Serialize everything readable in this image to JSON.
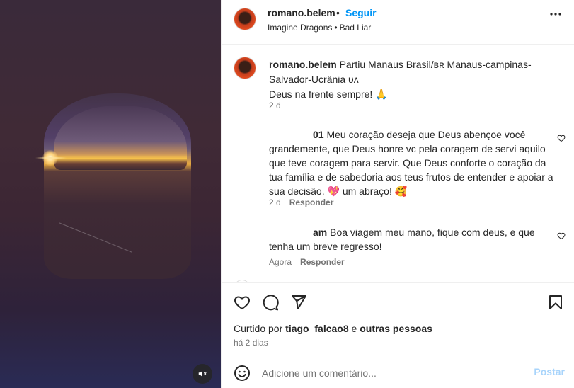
{
  "post": {
    "username": "romano.belem",
    "dot": "•",
    "follow_label": "Seguir",
    "audio_artist": "Imagine Dragons",
    "audio_sep": "•",
    "audio_title": "Bad Liar"
  },
  "caption": {
    "username": "romano.belem",
    "text_line": " Partiu Manaus Brasil/ʙʀ Manaus-campinas-Salvador-Ucrânia ᴜᴀ",
    "text_line2": "Deus na frente sempre! 🙏",
    "time": "2 d"
  },
  "comments": [
    {
      "username_fragment": "01",
      "text": " Meu coração deseja que Deus abençoe você grandemente, que Deus honre vc pela coragem de servi aquilo que teve coragem para servir. Que Deus conforte o coração da tua família e de sabedoria aos teus frutos de entender e apoiar a sua decisão. 💖 um abraço! 🥰",
      "time": "2 d",
      "reply_label": "Responder"
    },
    {
      "username_fragment": "am",
      "text": " Boa viagem meu mano, fique com deus, e que tenha um breve regresso!",
      "time": "Agora",
      "reply_label": "Responder"
    }
  ],
  "actions": {
    "liked_prefix": "Curtido por ",
    "liked_user": "tiago_falcao8",
    "liked_mid": " e ",
    "liked_others": "outras pessoas",
    "time_ago": "há 2 dias"
  },
  "add_comment": {
    "placeholder": "Adicione um comentário...",
    "post_label": "Postar"
  },
  "colors": {
    "accent": "#0095f6",
    "post_disabled": "#a8d4fb",
    "like_heart": "#262626"
  }
}
